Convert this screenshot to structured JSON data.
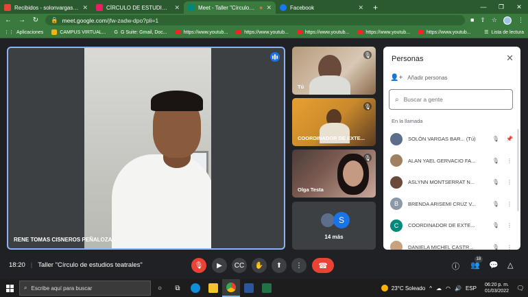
{
  "browser": {
    "tabs": [
      {
        "label": "Recibidos - solonvargas.docente",
        "color": "#ea4335",
        "active": false
      },
      {
        "label": "CÍRCULO DE ESTUDIOS TEATRAL",
        "color": "#e91e63",
        "active": false
      },
      {
        "label": "Meet - Taller \"Círculo de estu",
        "color": "#00897b",
        "active": true
      },
      {
        "label": "Facebook",
        "color": "#1877f2",
        "active": false
      }
    ],
    "url_host": "meet.google.com",
    "url_path": "/jfw-zadw-dpo?pli=1",
    "bookmarks": [
      {
        "label": "Aplicaciones",
        "kind": "apps"
      },
      {
        "label": "CAMPUS VIRTUAL...",
        "kind": "ico"
      },
      {
        "label": "G Suite: Gmail, Doc...",
        "kind": "g"
      },
      {
        "label": "https://www.youtub...",
        "kind": "yt"
      },
      {
        "label": "https://www.youtub...",
        "kind": "yt"
      },
      {
        "label": "https://www.youtub...",
        "kind": "yt"
      },
      {
        "label": "https://www.youtub...",
        "kind": "yt"
      },
      {
        "label": "https://www.youtub...",
        "kind": "yt"
      }
    ],
    "reading_list": "Lista de lectura"
  },
  "meet": {
    "main_speaker": "RENE TOMAS CISNEROS PEÑALOZA",
    "tiles": [
      {
        "name": "Tú"
      },
      {
        "name": "COORDINADOR DE EXTE..."
      },
      {
        "name": "Olga Testa"
      }
    ],
    "more_tile": {
      "avatar_letter": "S",
      "label": "14 más"
    },
    "time": "18:20",
    "meeting_title": "Taller \"Círculo de estudios teatrales\"",
    "participant_count": "18"
  },
  "people_panel": {
    "title": "Personas",
    "add_people": "Añadir personas",
    "search_placeholder": "Buscar a gente",
    "section": "En la llamada",
    "people": [
      {
        "name": "SOLÓN VARGAS BAR...  (Tú)",
        "avatar_color": "#5c6e8a",
        "letter": "",
        "action": "pin"
      },
      {
        "name": "ALAN YAEL GERVACIO FA...",
        "avatar_color": "#a08060",
        "letter": "",
        "action": "more"
      },
      {
        "name": "ASLYNN MONTSERRAT N...",
        "avatar_color": "#6a4a3a",
        "letter": "",
        "action": "more"
      },
      {
        "name": "BRENDA ARISEMI CRUZ V...",
        "avatar_color": "#8a98a8",
        "letter": "B",
        "action": "more"
      },
      {
        "name": "COORDINADOR DE EXTE...",
        "avatar_color": "#00897b",
        "letter": "C",
        "action": "more"
      },
      {
        "name": "DANIELA MICHEL CASTR...",
        "avatar_color": "#c9a080",
        "letter": "",
        "action": "more"
      }
    ]
  },
  "taskbar": {
    "search_placeholder": "Escribe aquí para buscar",
    "weather": "23°C  Soleado",
    "time": "06:20 p. m.",
    "date": "01/03/2022"
  }
}
